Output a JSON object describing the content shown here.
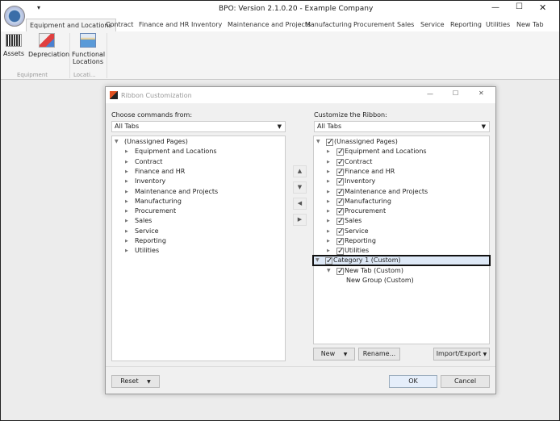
{
  "app": {
    "title": "BPO: Version 2.1.0.20 - Example Company",
    "qat_arrow": "▾"
  },
  "tabs": [
    "Equipment and Locations",
    "Contract",
    "Finance and HR",
    "Inventory",
    "Maintenance and Projects",
    "Manufacturing",
    "Procurement",
    "Sales",
    "Service",
    "Reporting",
    "Utilities",
    "New Tab"
  ],
  "ribbon": {
    "buttons": [
      "Assets",
      "Depreciation",
      "Functional Locations"
    ],
    "groups": [
      "Equipment",
      "Locati..."
    ]
  },
  "dialog": {
    "title": "Ribbon Customization",
    "left_label": "Choose commands from:",
    "left_combo": "All Tabs",
    "right_label": "Customize the Ribbon:",
    "right_combo": "All Tabs",
    "root": "(Unassigned Pages)",
    "pages": [
      "Equipment and Locations",
      "Contract",
      "Finance and HR",
      "Inventory",
      "Maintenance and Projects",
      "Manufacturing",
      "Procurement",
      "Sales",
      "Service",
      "Reporting",
      "Utilities"
    ],
    "custom": {
      "category": "Category 1 (Custom)",
      "tab": "New Tab (Custom)",
      "group": "New Group (Custom)"
    },
    "buttons": {
      "new": "New",
      "rename": "Rename...",
      "import_export": "Import/Export",
      "reset": "Reset",
      "ok": "OK",
      "cancel": "Cancel"
    }
  }
}
